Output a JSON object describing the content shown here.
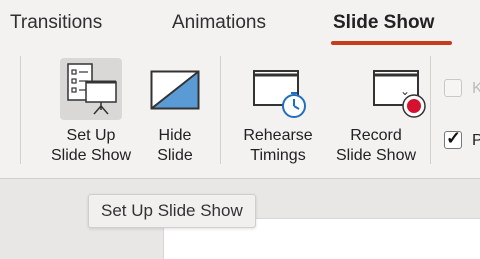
{
  "tabs": [
    {
      "label": "Transitions"
    },
    {
      "label": "Animations"
    },
    {
      "label": "Slide Show"
    }
  ],
  "commands": {
    "setup": {
      "label": "Set Up\nSlide Show"
    },
    "hide": {
      "label": "Hide\nSlide"
    },
    "rehearse": {
      "label": "Rehearse\nTimings"
    },
    "record": {
      "label": "Record\nSlide Show"
    }
  },
  "checkboxes": {
    "top": {
      "label": "K",
      "checked": false
    },
    "bottom": {
      "label": "P",
      "checked": true
    }
  },
  "tooltip": {
    "text": "Set Up Slide Show"
  },
  "colors": {
    "accent": "#c43e1c",
    "record_dot": "#d6112f",
    "hide_fill": "#5b9bd5"
  }
}
